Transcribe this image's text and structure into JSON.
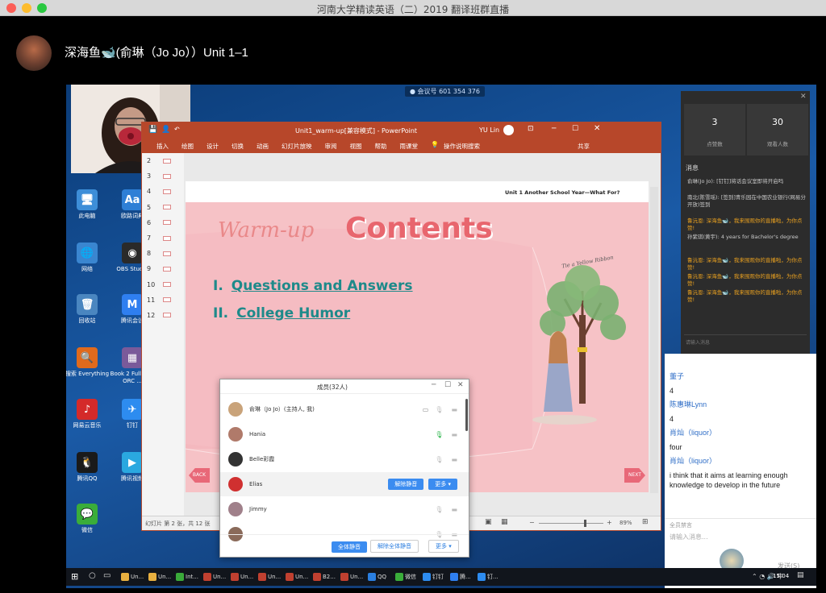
{
  "window": {
    "title": "河南大学精读英语（二）2019 翻译班群直播"
  },
  "streamer": {
    "name": "深海鱼🐋(俞琳（Jo Jo））Unit 1–1"
  },
  "meeting": {
    "id_label": "● 会议号 601 354 376"
  },
  "desktop_icons": [
    {
      "label": "此电脑",
      "color": "#3d8ed8",
      "glyph": "🖥"
    },
    {
      "label": "欧路词典",
      "color": "#2e7fd6",
      "glyph": "Aa"
    },
    {
      "label": "网络",
      "color": "#3a86d0",
      "glyph": "🌐"
    },
    {
      "label": "OBS Studio",
      "color": "#2a2a2a",
      "glyph": "◉"
    },
    {
      "label": "回收站",
      "color": "#4a86c0",
      "glyph": "🗑"
    },
    {
      "label": "腾讯会议",
      "color": "#2f7ff0",
      "glyph": "M"
    },
    {
      "label": "搜索 Everything",
      "color": "#e06a1c",
      "glyph": "🔍"
    },
    {
      "label": "Book 2 Full Text ORC ...",
      "color": "#7a5a9a",
      "glyph": "▦"
    },
    {
      "label": "网易云音乐",
      "color": "#d42a2a",
      "glyph": "♪"
    },
    {
      "label": "钉钉",
      "color": "#2d8cf0",
      "glyph": "✈"
    },
    {
      "label": "腾讯QQ",
      "color": "#1a1a1a",
      "glyph": "🐧"
    },
    {
      "label": "腾讯视频",
      "color": "#2aa8e0",
      "glyph": "▶"
    },
    {
      "label": "微信",
      "color": "#3aad3a",
      "glyph": "💬"
    }
  ],
  "ppt": {
    "title": "Unit1_warm-up[兼容模式] - PowerPoint",
    "user": "YU Lin",
    "ribbon": [
      "插入",
      "绘图",
      "设计",
      "切换",
      "动画",
      "幻灯片放映",
      "审阅",
      "视图",
      "帮助",
      "雨课堂"
    ],
    "tell_me": "操作说明搜索",
    "share": "共享",
    "slide_numbers": [
      "2",
      "3",
      "4",
      "5",
      "6",
      "7",
      "8",
      "9",
      "10",
      "11",
      "12"
    ],
    "status_left": "幻灯片 第 2 张，共 12 张",
    "zoom": "89%",
    "slide": {
      "header": "Unit 1  Another School Year—What For?",
      "warmup": "Warm-up",
      "contents": "Contents",
      "items": [
        {
          "num": "I.",
          "text": "Questions and Answers"
        },
        {
          "num": "II.",
          "text": "College Humor"
        }
      ],
      "ribbon_text": "Tie a Yellow Ribbon",
      "back": "BACK",
      "next": "NEXT"
    }
  },
  "members": {
    "title": "成员(32人)",
    "rows": [
      {
        "name": "俞琳（Jo Jo）(主持人, 我)",
        "color": "#c9a37a"
      },
      {
        "name": "Hania",
        "color": "#b07a6a"
      },
      {
        "name": "Belle彩霞",
        "color": "#333333"
      },
      {
        "name": "Elias",
        "color": "#d03030"
      },
      {
        "name": "Jimmy",
        "color": "#a0808a"
      },
      {
        "name": "",
        "color": "#8a6a5a"
      }
    ],
    "unmute_btn": "解除静音",
    "more_btn": "更多 ▾",
    "mute_all": "全体静音",
    "unmute_all": "解除全体静音",
    "more_bottom": "更多 ▾"
  },
  "stats": {
    "likes": "3",
    "likes_label": "点赞数",
    "viewers": "30",
    "viewers_label": "观看人数",
    "section": "消息",
    "messages": [
      {
        "text": "俞琳(Jo Jo): [钉钉]将话会议室即将开启吗"
      },
      {
        "text": "南北(陈雪瑶): [签到]青乐园在中国农业银行(网易分开放)签到"
      },
      {
        "text": "鲁沅恩: 深海鱼🐋，我来围观你的直播啦，为你点赞!",
        "hl": true
      },
      {
        "text": "孙紫琪(黄宇): 4 years for Bachelor's degree"
      },
      {
        "text": "鲁沅恩: 深海鱼🐋，我来围观你的直播啦，为你点赞!",
        "hl": true
      },
      {
        "text": "鲁沅恩: 深海鱼🐋，我来围观你的直播啦，为你点赞!",
        "hl": true
      },
      {
        "text": "鲁沅恩: 深海鱼🐋，我来围观你的直播啦，为你点赞!",
        "hl": true
      }
    ],
    "input_placeholder": "请输入消息",
    "send": "发送"
  },
  "chat": {
    "messages": [
      {
        "text": "董子",
        "type": "nm"
      },
      {
        "text": "4",
        "type": "tx"
      },
      {
        "text": "陈惠琳Lynn",
        "type": "nm"
      },
      {
        "text": "4",
        "type": "tx"
      },
      {
        "text": "肖灿（liquor）",
        "type": "nm"
      },
      {
        "text": "four",
        "type": "tx"
      },
      {
        "text": "肖灿（liquor）",
        "type": "nm"
      },
      {
        "text": "i think that it aims at learning enough knowledge to develop in the future",
        "type": "tx"
      }
    ],
    "placeholder": "请输入消息...",
    "send": "发送(S)",
    "hint": "全员禁言"
  },
  "taskbar": {
    "items": [
      {
        "label": "Un...",
        "color": "#e8b040"
      },
      {
        "label": "Un...",
        "color": "#e8b040"
      },
      {
        "label": "Int...",
        "color": "#3aaa3a"
      },
      {
        "label": "Un...",
        "color": "#c04030"
      },
      {
        "label": "Un...",
        "color": "#c04030"
      },
      {
        "label": "Un...",
        "color": "#c04030"
      },
      {
        "label": "Un...",
        "color": "#c04030"
      },
      {
        "label": "B2...",
        "color": "#c04030"
      },
      {
        "label": "Un...",
        "color": "#c04030"
      },
      {
        "label": "QQ",
        "color": "#2a7fe0"
      },
      {
        "label": "微信",
        "color": "#3aad3a"
      },
      {
        "label": "钉钉",
        "color": "#2d8cf0"
      },
      {
        "label": "腾...",
        "color": "#2f7ff0"
      },
      {
        "label": "钉...",
        "color": "#2d8cf0"
      }
    ],
    "clock": "15:04"
  }
}
